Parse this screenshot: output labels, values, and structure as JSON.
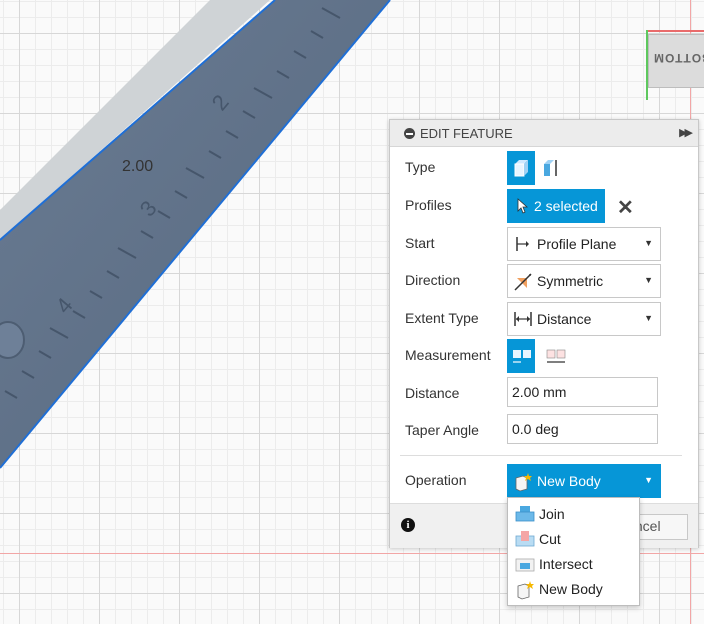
{
  "viewport": {
    "dimension_value": "2.00",
    "viewcube_face": "BOTTOM",
    "ruler_numbers": [
      "2",
      "3",
      "4"
    ]
  },
  "panel": {
    "title": "EDIT FEATURE",
    "rows": {
      "type": {
        "label": "Type"
      },
      "profiles": {
        "label": "Profiles",
        "value": "2 selected"
      },
      "start": {
        "label": "Start",
        "value": "Profile Plane"
      },
      "direction": {
        "label": "Direction",
        "value": "Symmetric"
      },
      "extent_type": {
        "label": "Extent Type",
        "value": "Distance"
      },
      "measurement": {
        "label": "Measurement"
      },
      "distance": {
        "label": "Distance",
        "value": "2.00 mm"
      },
      "taper_angle": {
        "label": "Taper Angle",
        "value": "0.0 deg"
      },
      "operation": {
        "label": "Operation",
        "value": "New Body"
      }
    },
    "footer": {
      "cancel_label": "Cancel"
    }
  },
  "operation_menu": {
    "items": [
      {
        "label": "Join",
        "icon": "join-icon"
      },
      {
        "label": "Cut",
        "icon": "cut-icon"
      },
      {
        "label": "Intersect",
        "icon": "intersect-icon"
      },
      {
        "label": "New Body",
        "icon": "new-body-icon"
      }
    ]
  },
  "colors": {
    "accent": "#0696d7",
    "model_body": "#5e7189",
    "edge_highlight": "#1f6fd6"
  }
}
